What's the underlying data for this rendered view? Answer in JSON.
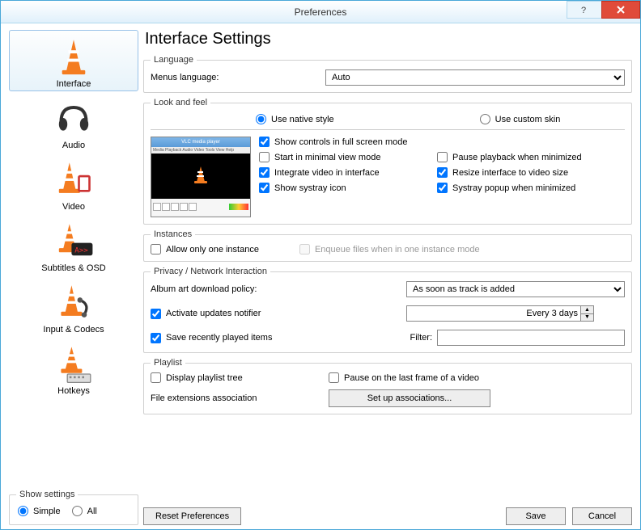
{
  "window": {
    "title": "Preferences"
  },
  "sidebar": {
    "items": [
      {
        "label": "Interface"
      },
      {
        "label": "Audio"
      },
      {
        "label": "Video"
      },
      {
        "label": "Subtitles & OSD"
      },
      {
        "label": "Input & Codecs"
      },
      {
        "label": "Hotkeys"
      }
    ],
    "show_settings": {
      "legend": "Show settings",
      "simple": "Simple",
      "all": "All"
    }
  },
  "heading": "Interface Settings",
  "language": {
    "legend": "Language",
    "label": "Menus language:",
    "value": "Auto"
  },
  "lookfeel": {
    "legend": "Look and feel",
    "native": "Use native style",
    "custom": "Use custom skin",
    "show_controls": "Show controls in full screen mode",
    "start_minimal": "Start in minimal view mode",
    "pause_minimized": "Pause playback when minimized",
    "integrate": "Integrate video in interface",
    "resize": "Resize interface to video size",
    "show_systray": "Show systray icon",
    "systray_popup": "Systray popup when minimized",
    "preview_title": "VLC media player",
    "preview_menu": "Media Playback Audio Video Tools View Help"
  },
  "instances": {
    "legend": "Instances",
    "allow_one": "Allow only one instance",
    "enqueue": "Enqueue files when in one instance mode"
  },
  "privacy": {
    "legend": "Privacy / Network Interaction",
    "album_art_label": "Album art download policy:",
    "album_art_value": "As soon as track is added",
    "updates": "Activate updates notifier",
    "updates_interval": "Every 3 days",
    "save_recent": "Save recently played items",
    "filter_label": "Filter:",
    "filter_value": ""
  },
  "playlist": {
    "legend": "Playlist",
    "display_tree": "Display playlist tree",
    "pause_last": "Pause on the last frame of a video",
    "ext_label": "File extensions association",
    "setup_btn": "Set up associations..."
  },
  "footer": {
    "reset": "Reset Preferences",
    "save": "Save",
    "cancel": "Cancel"
  }
}
